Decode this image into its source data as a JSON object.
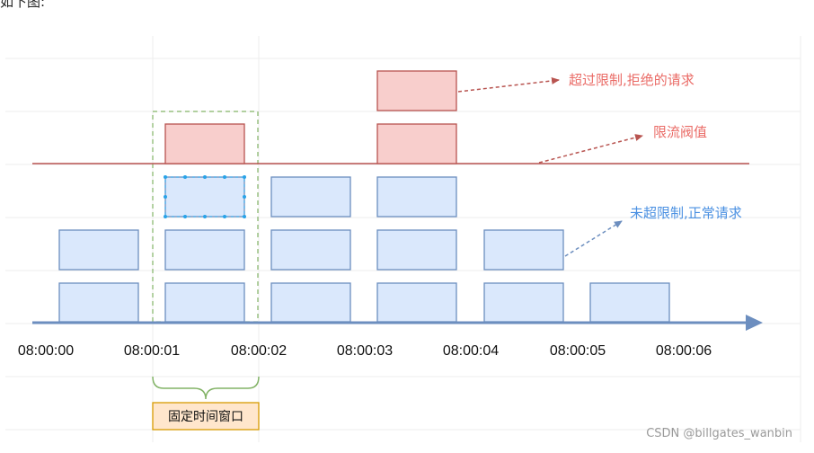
{
  "header": {
    "text": "如下图:"
  },
  "diagram": {
    "ticks": [
      "08:00:00",
      "08:00:01",
      "08:00:02",
      "08:00:03",
      "08:00:04",
      "08:00:05",
      "08:00:06"
    ],
    "annotations": {
      "rejected": "超过限制,拒绝的请求",
      "threshold": "限流阀值",
      "accepted": "未超限制,正常请求"
    },
    "window_label": "固定时间窗口",
    "colors": {
      "blue_fill": "#dae8fc",
      "blue_stroke": "#6c8ebf",
      "red_fill": "#f8cecc",
      "red_stroke": "#b85450",
      "red_text": "#ea6b66",
      "blue_text": "#4a90e2",
      "green": "#82b366",
      "label_fill": "#ffe6cc",
      "label_stroke": "#d79b00"
    }
  },
  "watermark": {
    "text": "CSDN @billgates_wanbin"
  }
}
